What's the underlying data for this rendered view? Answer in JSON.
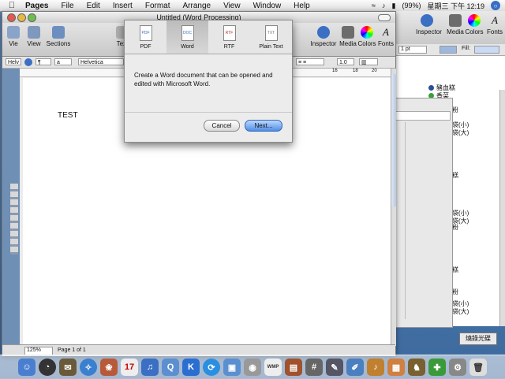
{
  "menubar": {
    "apple": "",
    "items": [
      "Pages",
      "File",
      "Edit",
      "Insert",
      "Format",
      "Arrange",
      "View",
      "Window",
      "Help"
    ],
    "battery": "(99%)",
    "clock": "星期三 下午 12:19"
  },
  "back_window": {
    "toolbar": [
      "Inspector",
      "Media",
      "Colors",
      "Fonts"
    ],
    "stroke": "1 pt",
    "fill_label": "Fill:",
    "legend": [
      "豬血糕",
      "香菜"
    ],
    "text_bits": [
      "粉",
      "袋(小)",
      "袋(大)",
      "糕",
      "袋(小)",
      "袋(大)",
      "粉",
      "糕",
      "粉",
      "袋(小)",
      "袋(大)"
    ]
  },
  "main_window": {
    "title": "Untitled (Word Processing)",
    "toolbar": {
      "view": "View",
      "sections": "Sections",
      "text": "Text",
      "inspector": "Inspector",
      "media": "Media",
      "colors": "Colors",
      "fonts": "Fonts"
    },
    "formatbar": {
      "style": "Helv",
      "font": "Helvetica",
      "spacing": "1.0",
      "stroke": "1 pt",
      "fill_label": "Fill:"
    },
    "ruler_marks": [
      "16",
      "18",
      "20"
    ],
    "doc_text": "TEST",
    "status": {
      "zoom": "125%",
      "page": "Page 1 of 1"
    }
  },
  "export_sheet": {
    "formats": [
      {
        "label": "PDF",
        "icon": "PDF",
        "selected": false
      },
      {
        "label": "Word",
        "icon": "DOC",
        "selected": true
      },
      {
        "label": "RTF",
        "icon": "RTF",
        "selected": false
      },
      {
        "label": "Plain Text",
        "icon": "TXT",
        "selected": false
      }
    ],
    "description": "Create a Word document that can be opened and edited with Microsoft Word.",
    "cancel": "Cancel",
    "next": "Next..."
  },
  "desktop": {
    "burn_button": "燒錄光碟"
  },
  "colors": {
    "accent": "#4f8ee6",
    "legend_blue": "#2a4f9a",
    "legend_green": "#3aa03a"
  }
}
